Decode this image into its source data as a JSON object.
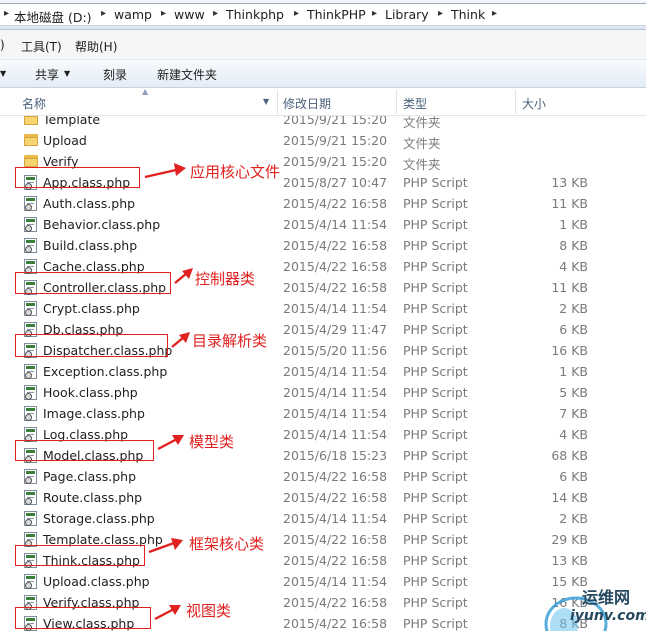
{
  "address": {
    "crumbs": [
      "本地磁盘 (D:)",
      "wamp",
      "www",
      "Thinkphp",
      "ThinkPHP",
      "Library",
      "Think"
    ]
  },
  "menu": {
    "tools": "工具(T)",
    "help": "帮助(H)"
  },
  "toolbar": {
    "share": "共享",
    "burn": "刻录",
    "new_folder": "新建文件夹"
  },
  "columns": {
    "name": "名称",
    "date": "修改日期",
    "type": "类型",
    "size": "大小"
  },
  "files": [
    {
      "name": "Template",
      "date": "2015/9/21 15:20",
      "type": "文件夹",
      "size": "",
      "kind": "folder"
    },
    {
      "name": "Upload",
      "date": "2015/9/21 15:20",
      "type": "文件夹",
      "size": "",
      "kind": "folder"
    },
    {
      "name": "Verify",
      "date": "2015/9/21 15:20",
      "type": "文件夹",
      "size": "",
      "kind": "folder"
    },
    {
      "name": "App.class.php",
      "date": "2015/8/27 10:47",
      "type": "PHP Script",
      "size": "13 KB",
      "kind": "php"
    },
    {
      "name": "Auth.class.php",
      "date": "2015/4/22 16:58",
      "type": "PHP Script",
      "size": "11 KB",
      "kind": "php"
    },
    {
      "name": "Behavior.class.php",
      "date": "2015/4/14 11:54",
      "type": "PHP Script",
      "size": "1 KB",
      "kind": "php"
    },
    {
      "name": "Build.class.php",
      "date": "2015/4/22 16:58",
      "type": "PHP Script",
      "size": "8 KB",
      "kind": "php"
    },
    {
      "name": "Cache.class.php",
      "date": "2015/4/22 16:58",
      "type": "PHP Script",
      "size": "4 KB",
      "kind": "php"
    },
    {
      "name": "Controller.class.php",
      "date": "2015/4/22 16:58",
      "type": "PHP Script",
      "size": "11 KB",
      "kind": "php"
    },
    {
      "name": "Crypt.class.php",
      "date": "2015/4/14 11:54",
      "type": "PHP Script",
      "size": "2 KB",
      "kind": "php"
    },
    {
      "name": "Db.class.php",
      "date": "2015/4/29 11:47",
      "type": "PHP Script",
      "size": "6 KB",
      "kind": "php"
    },
    {
      "name": "Dispatcher.class.php",
      "date": "2015/5/20 11:56",
      "type": "PHP Script",
      "size": "16 KB",
      "kind": "php"
    },
    {
      "name": "Exception.class.php",
      "date": "2015/4/14 11:54",
      "type": "PHP Script",
      "size": "1 KB",
      "kind": "php"
    },
    {
      "name": "Hook.class.php",
      "date": "2015/4/14 11:54",
      "type": "PHP Script",
      "size": "5 KB",
      "kind": "php"
    },
    {
      "name": "Image.class.php",
      "date": "2015/4/14 11:54",
      "type": "PHP Script",
      "size": "7 KB",
      "kind": "php"
    },
    {
      "name": "Log.class.php",
      "date": "2015/4/14 11:54",
      "type": "PHP Script",
      "size": "4 KB",
      "kind": "php"
    },
    {
      "name": "Model.class.php",
      "date": "2015/6/18 15:23",
      "type": "PHP Script",
      "size": "68 KB",
      "kind": "php"
    },
    {
      "name": "Page.class.php",
      "date": "2015/4/22 16:58",
      "type": "PHP Script",
      "size": "6 KB",
      "kind": "php"
    },
    {
      "name": "Route.class.php",
      "date": "2015/4/22 16:58",
      "type": "PHP Script",
      "size": "14 KB",
      "kind": "php"
    },
    {
      "name": "Storage.class.php",
      "date": "2015/4/14 11:54",
      "type": "PHP Script",
      "size": "2 KB",
      "kind": "php"
    },
    {
      "name": "Template.class.php",
      "date": "2015/4/22 16:58",
      "type": "PHP Script",
      "size": "29 KB",
      "kind": "php"
    },
    {
      "name": "Think.class.php",
      "date": "2015/4/22 16:58",
      "type": "PHP Script",
      "size": "13 KB",
      "kind": "php"
    },
    {
      "name": "Upload.class.php",
      "date": "2015/4/14 11:54",
      "type": "PHP Script",
      "size": "15 KB",
      "kind": "php"
    },
    {
      "name": "Verify.class.php",
      "date": "2015/4/22 16:58",
      "type": "PHP Script",
      "size": "16 KB",
      "kind": "php"
    },
    {
      "name": "View.class.php",
      "date": "2015/4/22 16:58",
      "type": "PHP Script",
      "size": "8 KB",
      "kind": "php"
    }
  ],
  "annotations": {
    "app": "应用核心文件",
    "controller": "控制器类",
    "dispatcher": "目录解析类",
    "model": "模型类",
    "think": "框架核心类",
    "view": "视图类"
  },
  "watermark": {
    "line1": "运维网",
    "line2": "iyunv.com"
  },
  "colors": {
    "annotation": "#e0211f",
    "folder": "#f7d571",
    "header_text": "#4c607a"
  }
}
